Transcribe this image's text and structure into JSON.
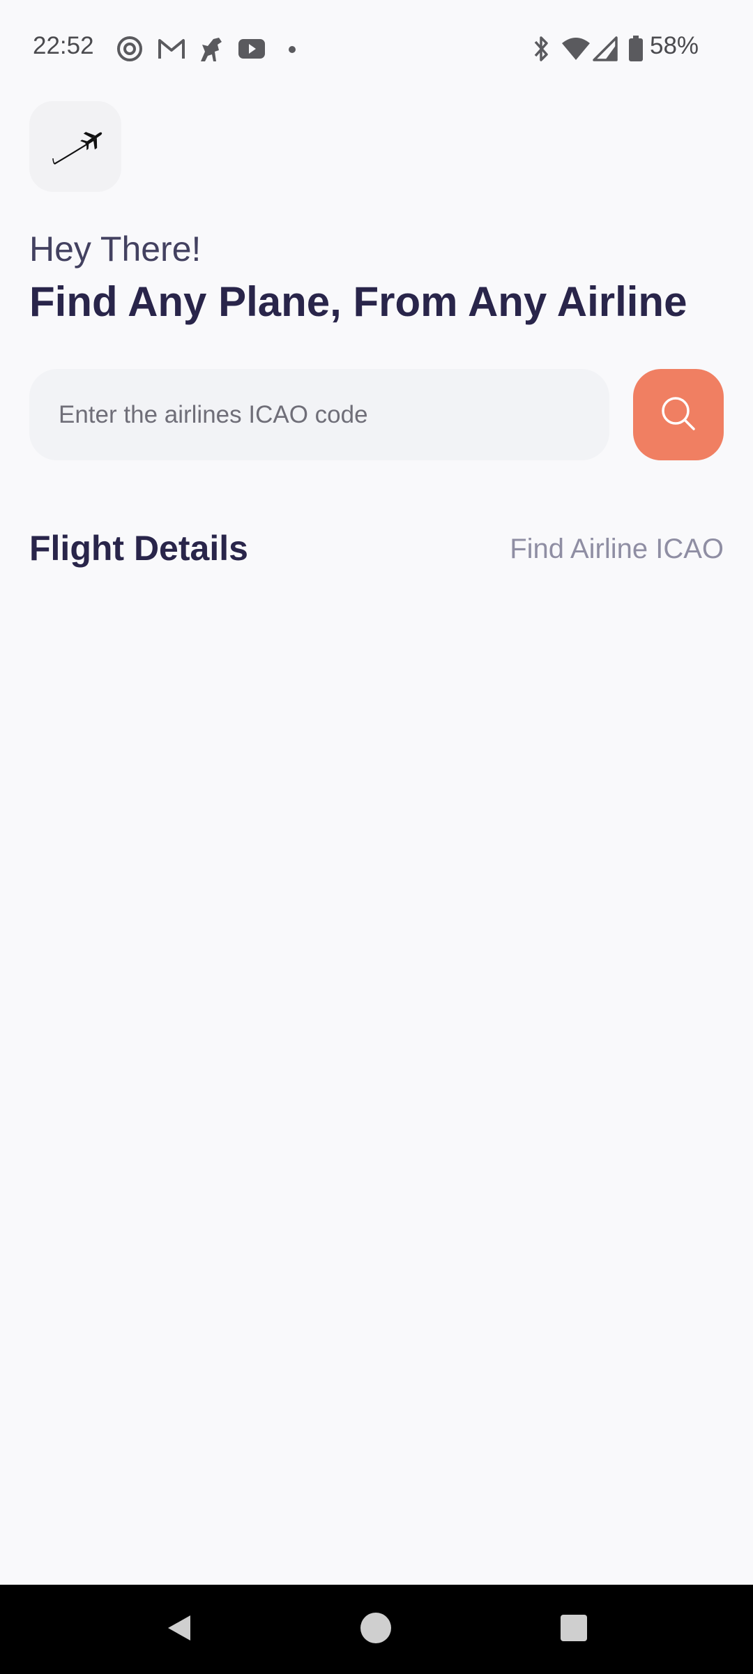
{
  "status_bar": {
    "time": "22:52",
    "battery_percent": "58%",
    "notification_icons": [
      "threads-icon",
      "gmail-icon",
      "horse-app-icon",
      "youtube-icon",
      "dot-icon"
    ],
    "system_icons": [
      "bluetooth-icon",
      "wifi-icon",
      "cell-signal-icon",
      "battery-icon"
    ]
  },
  "header": {
    "logo_icon": "plane-logo-icon",
    "greeting": "Hey There!",
    "headline": "Find Any Plane, From Any Airline"
  },
  "search": {
    "placeholder": "Enter the airlines ICAO code",
    "value": "",
    "button_icon": "search-icon"
  },
  "flight_section": {
    "title": "Flight Details",
    "link_label": "Find Airline ICAO"
  },
  "nav_bar": {
    "buttons": [
      "back-icon",
      "home-icon",
      "recents-icon"
    ]
  },
  "colors": {
    "background": "#f9f9fb",
    "accent": "#f07f62",
    "headline": "#29254a",
    "field_bg": "#f2f3f6",
    "link": "#8f8ea3"
  }
}
